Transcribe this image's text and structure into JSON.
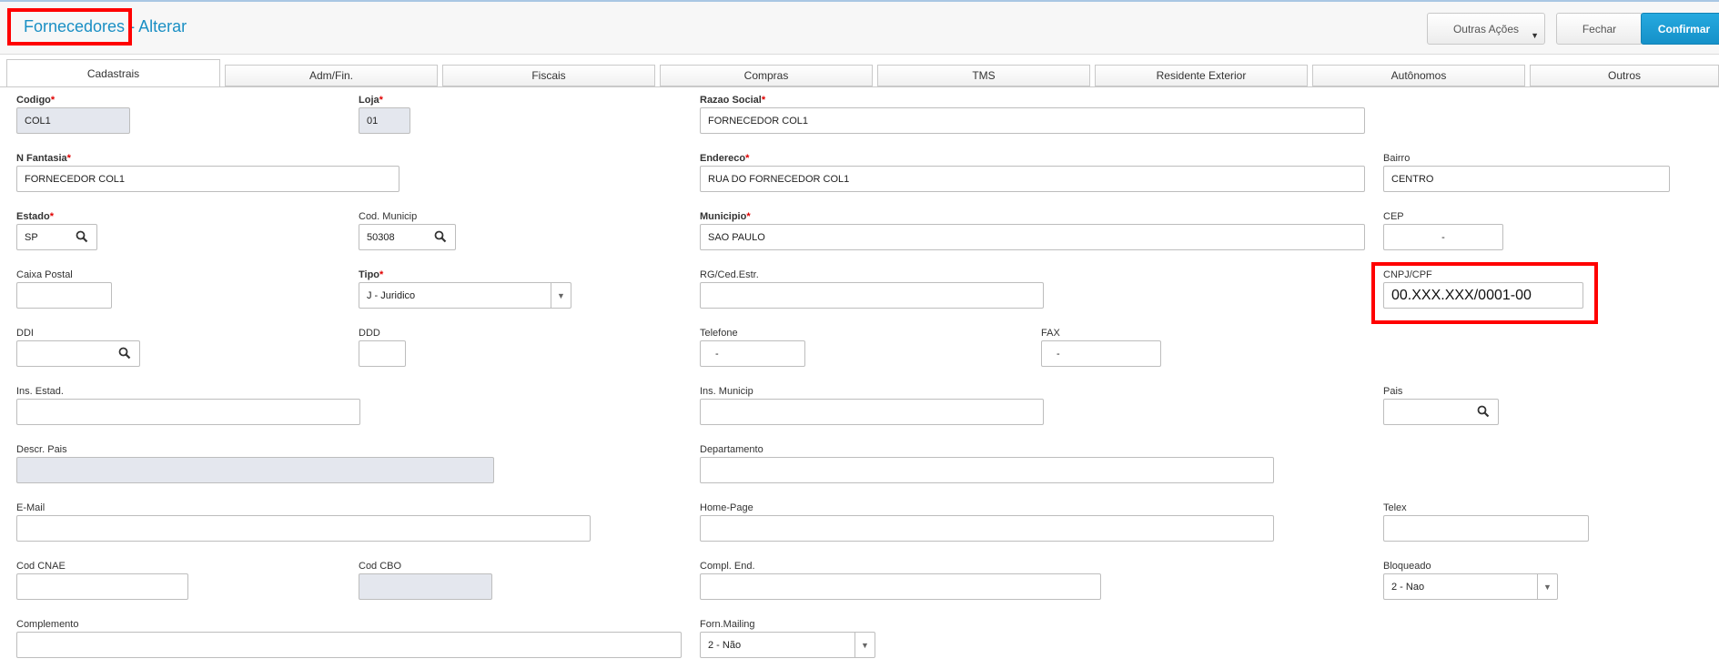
{
  "header": {
    "title_main": "Fornecedores",
    "title_sep": " - ",
    "title_action": "Alterar",
    "buttons": {
      "outras": "Outras Ações",
      "fechar": "Fechar",
      "confirmar": "Confirmar"
    }
  },
  "tabs": [
    "Cadastrais",
    "Adm/Fin.",
    "Fiscais",
    "Compras",
    "TMS",
    "Residente Exterior",
    "Autônomos",
    "Outros"
  ],
  "fields": {
    "codigo": {
      "label": "Codigo",
      "value": "COL1"
    },
    "loja": {
      "label": "Loja",
      "value": "01"
    },
    "razao": {
      "label": "Razao Social",
      "value": "FORNECEDOR COL1"
    },
    "fantasia": {
      "label": "N Fantasia",
      "value": "FORNECEDOR COL1"
    },
    "endereco": {
      "label": "Endereco",
      "value": "RUA DO FORNECEDOR COL1"
    },
    "bairro": {
      "label": "Bairro",
      "value": "CENTRO"
    },
    "estado": {
      "label": "Estado",
      "value": "SP"
    },
    "codmun": {
      "label": "Cod. Municip",
      "value": "50308"
    },
    "municipio": {
      "label": "Municipio",
      "value": "SAO PAULO"
    },
    "cep": {
      "label": "CEP",
      "value": "-"
    },
    "caixa": {
      "label": "Caixa Postal",
      "value": ""
    },
    "tipo": {
      "label": "Tipo",
      "value": "J - Juridico"
    },
    "rg": {
      "label": "RG/Ced.Estr.",
      "value": ""
    },
    "cnpj": {
      "label": "CNPJ/CPF",
      "value": "00.XXX.XXX/0001-00"
    },
    "ddi": {
      "label": "DDI",
      "value": ""
    },
    "ddd": {
      "label": "DDD",
      "value": ""
    },
    "telefone": {
      "label": "Telefone",
      "value": "-"
    },
    "fax": {
      "label": "FAX",
      "value": "-"
    },
    "insest": {
      "label": "Ins. Estad.",
      "value": ""
    },
    "insmun": {
      "label": "Ins. Municip",
      "value": ""
    },
    "pais": {
      "label": "Pais",
      "value": ""
    },
    "descrpais": {
      "label": "Descr. Pais",
      "value": ""
    },
    "departamento": {
      "label": "Departamento",
      "value": ""
    },
    "email": {
      "label": "E-Mail",
      "value": ""
    },
    "homepage": {
      "label": "Home-Page",
      "value": ""
    },
    "telex": {
      "label": "Telex",
      "value": ""
    },
    "cnae": {
      "label": "Cod CNAE",
      "value": ""
    },
    "cbo": {
      "label": "Cod CBO",
      "value": ""
    },
    "complend": {
      "label": "Compl. End.",
      "value": ""
    },
    "bloqueado": {
      "label": "Bloqueado",
      "value": "2 - Nao"
    },
    "complemento": {
      "label": "Complemento",
      "value": ""
    },
    "mailing": {
      "label": "Forn.Mailing",
      "value": "2 - Não"
    }
  },
  "colors": {
    "accent": "#1a8fc4",
    "highlight": "#ff0000",
    "required_star": "#e00000",
    "readonly_bg": "#e4e7ee"
  }
}
